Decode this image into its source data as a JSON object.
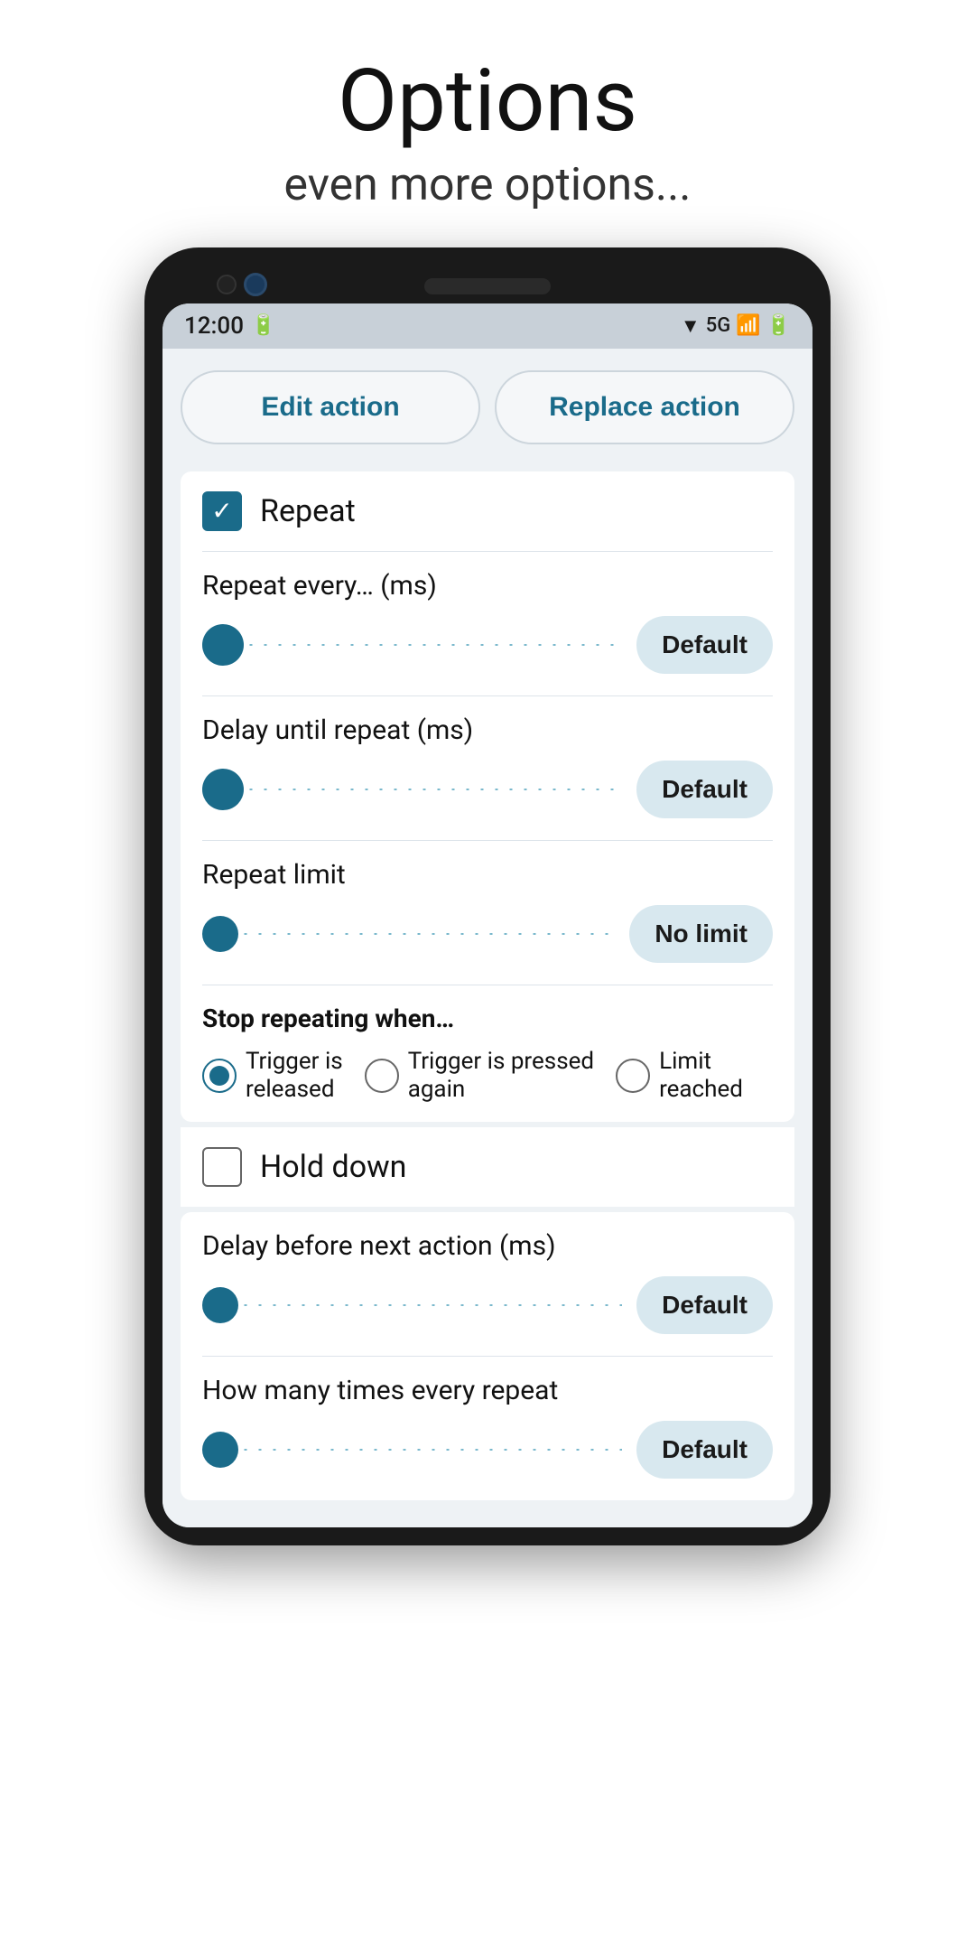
{
  "header": {
    "title": "Options",
    "subtitle": "even more options..."
  },
  "status_bar": {
    "time": "12:00",
    "network": "5G",
    "wifi": true,
    "battery": true
  },
  "action_buttons": {
    "edit_label": "Edit action",
    "replace_label": "Replace action"
  },
  "repeat_section": {
    "label": "Repeat",
    "checked": true
  },
  "repeat_every": {
    "label": "Repeat every… (ms)",
    "value": "Default"
  },
  "delay_until_repeat": {
    "label": "Delay until repeat (ms)",
    "value": "Default"
  },
  "repeat_limit": {
    "label": "Repeat limit",
    "value": "No limit"
  },
  "stop_repeating": {
    "label": "Stop repeating when…",
    "options": [
      {
        "id": "trigger_released",
        "label": "Trigger is\nreleased",
        "selected": true
      },
      {
        "id": "trigger_pressed",
        "label": "Trigger is pressed\nagain",
        "selected": false
      },
      {
        "id": "limit_reached",
        "label": "Limit\nreached",
        "selected": false
      }
    ]
  },
  "hold_down": {
    "label": "Hold down",
    "checked": false
  },
  "delay_before_next": {
    "label": "Delay before next action (ms)",
    "value": "Default"
  },
  "how_many_times": {
    "label": "How many times every repeat",
    "value": "Default"
  }
}
